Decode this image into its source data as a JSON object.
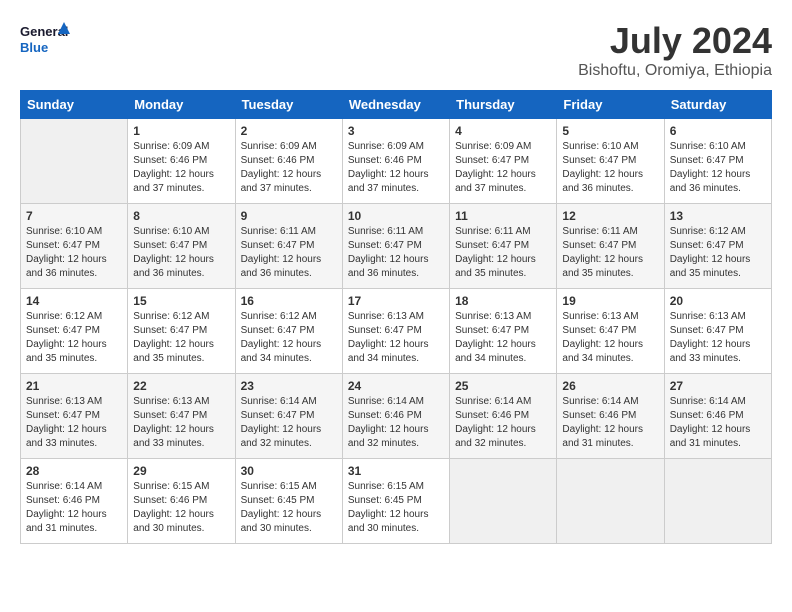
{
  "header": {
    "logo_line1": "General",
    "logo_line2": "Blue",
    "month": "July 2024",
    "location": "Bishoftu, Oromiya, Ethiopia"
  },
  "weekdays": [
    "Sunday",
    "Monday",
    "Tuesday",
    "Wednesday",
    "Thursday",
    "Friday",
    "Saturday"
  ],
  "weeks": [
    [
      {
        "day": "",
        "info": ""
      },
      {
        "day": "1",
        "info": "Sunrise: 6:09 AM\nSunset: 6:46 PM\nDaylight: 12 hours\nand 37 minutes."
      },
      {
        "day": "2",
        "info": "Sunrise: 6:09 AM\nSunset: 6:46 PM\nDaylight: 12 hours\nand 37 minutes."
      },
      {
        "day": "3",
        "info": "Sunrise: 6:09 AM\nSunset: 6:46 PM\nDaylight: 12 hours\nand 37 minutes."
      },
      {
        "day": "4",
        "info": "Sunrise: 6:09 AM\nSunset: 6:47 PM\nDaylight: 12 hours\nand 37 minutes."
      },
      {
        "day": "5",
        "info": "Sunrise: 6:10 AM\nSunset: 6:47 PM\nDaylight: 12 hours\nand 36 minutes."
      },
      {
        "day": "6",
        "info": "Sunrise: 6:10 AM\nSunset: 6:47 PM\nDaylight: 12 hours\nand 36 minutes."
      }
    ],
    [
      {
        "day": "7",
        "info": "Sunrise: 6:10 AM\nSunset: 6:47 PM\nDaylight: 12 hours\nand 36 minutes."
      },
      {
        "day": "8",
        "info": "Sunrise: 6:10 AM\nSunset: 6:47 PM\nDaylight: 12 hours\nand 36 minutes."
      },
      {
        "day": "9",
        "info": "Sunrise: 6:11 AM\nSunset: 6:47 PM\nDaylight: 12 hours\nand 36 minutes."
      },
      {
        "day": "10",
        "info": "Sunrise: 6:11 AM\nSunset: 6:47 PM\nDaylight: 12 hours\nand 36 minutes."
      },
      {
        "day": "11",
        "info": "Sunrise: 6:11 AM\nSunset: 6:47 PM\nDaylight: 12 hours\nand 35 minutes."
      },
      {
        "day": "12",
        "info": "Sunrise: 6:11 AM\nSunset: 6:47 PM\nDaylight: 12 hours\nand 35 minutes."
      },
      {
        "day": "13",
        "info": "Sunrise: 6:12 AM\nSunset: 6:47 PM\nDaylight: 12 hours\nand 35 minutes."
      }
    ],
    [
      {
        "day": "14",
        "info": "Sunrise: 6:12 AM\nSunset: 6:47 PM\nDaylight: 12 hours\nand 35 minutes."
      },
      {
        "day": "15",
        "info": "Sunrise: 6:12 AM\nSunset: 6:47 PM\nDaylight: 12 hours\nand 35 minutes."
      },
      {
        "day": "16",
        "info": "Sunrise: 6:12 AM\nSunset: 6:47 PM\nDaylight: 12 hours\nand 34 minutes."
      },
      {
        "day": "17",
        "info": "Sunrise: 6:13 AM\nSunset: 6:47 PM\nDaylight: 12 hours\nand 34 minutes."
      },
      {
        "day": "18",
        "info": "Sunrise: 6:13 AM\nSunset: 6:47 PM\nDaylight: 12 hours\nand 34 minutes."
      },
      {
        "day": "19",
        "info": "Sunrise: 6:13 AM\nSunset: 6:47 PM\nDaylight: 12 hours\nand 34 minutes."
      },
      {
        "day": "20",
        "info": "Sunrise: 6:13 AM\nSunset: 6:47 PM\nDaylight: 12 hours\nand 33 minutes."
      }
    ],
    [
      {
        "day": "21",
        "info": "Sunrise: 6:13 AM\nSunset: 6:47 PM\nDaylight: 12 hours\nand 33 minutes."
      },
      {
        "day": "22",
        "info": "Sunrise: 6:13 AM\nSunset: 6:47 PM\nDaylight: 12 hours\nand 33 minutes."
      },
      {
        "day": "23",
        "info": "Sunrise: 6:14 AM\nSunset: 6:47 PM\nDaylight: 12 hours\nand 32 minutes."
      },
      {
        "day": "24",
        "info": "Sunrise: 6:14 AM\nSunset: 6:46 PM\nDaylight: 12 hours\nand 32 minutes."
      },
      {
        "day": "25",
        "info": "Sunrise: 6:14 AM\nSunset: 6:46 PM\nDaylight: 12 hours\nand 32 minutes."
      },
      {
        "day": "26",
        "info": "Sunrise: 6:14 AM\nSunset: 6:46 PM\nDaylight: 12 hours\nand 31 minutes."
      },
      {
        "day": "27",
        "info": "Sunrise: 6:14 AM\nSunset: 6:46 PM\nDaylight: 12 hours\nand 31 minutes."
      }
    ],
    [
      {
        "day": "28",
        "info": "Sunrise: 6:14 AM\nSunset: 6:46 PM\nDaylight: 12 hours\nand 31 minutes."
      },
      {
        "day": "29",
        "info": "Sunrise: 6:15 AM\nSunset: 6:46 PM\nDaylight: 12 hours\nand 30 minutes."
      },
      {
        "day": "30",
        "info": "Sunrise: 6:15 AM\nSunset: 6:45 PM\nDaylight: 12 hours\nand 30 minutes."
      },
      {
        "day": "31",
        "info": "Sunrise: 6:15 AM\nSunset: 6:45 PM\nDaylight: 12 hours\nand 30 minutes."
      },
      {
        "day": "",
        "info": ""
      },
      {
        "day": "",
        "info": ""
      },
      {
        "day": "",
        "info": ""
      }
    ]
  ]
}
